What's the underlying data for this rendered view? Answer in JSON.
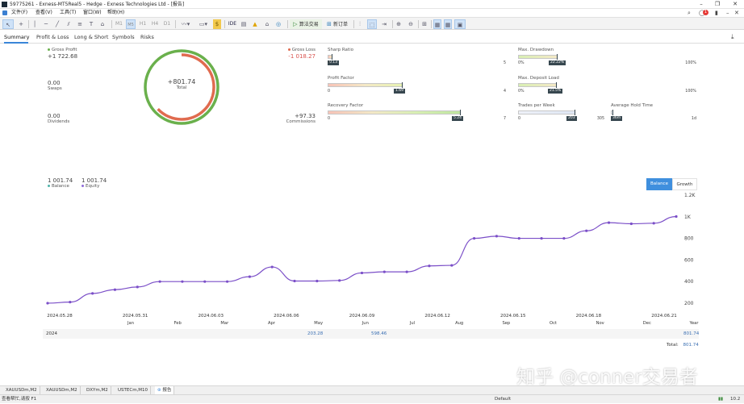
{
  "window": {
    "title": "59775261 - Exness-MT5Real5 - Hedge - Exness Technologies Ltd - [报告]"
  },
  "menu": {
    "items": [
      "文件(F)",
      "查看(V)",
      "工具(T)",
      "窗口(W)",
      "帮助(H)"
    ],
    "notification_count": "1"
  },
  "toolbar": {
    "timeframes": [
      "M1",
      "M5",
      "M15",
      "M30",
      "H1",
      "H4",
      "D1"
    ],
    "timeframes_short": {
      "m2": "M2",
      "m10": "M10"
    },
    "algo_trading": "算法交易",
    "new_order": "新订单",
    "ide_label": "IDE"
  },
  "tabs": [
    "Summary",
    "Profit & Loss",
    "Long & Short",
    "Symbols",
    "Risks"
  ],
  "summary": {
    "gross_profit_label": "Gross Profit",
    "gross_profit": "+1 722.68",
    "gross_loss_label": "Gross Loss",
    "gross_loss": "-1 018.27",
    "swaps_value": "0.00",
    "swaps_label": "Swaps",
    "dividends_value": "0.00",
    "dividends_label": "Dividends",
    "total_value": "+801.74",
    "total_label": "Total",
    "commissions_value": "+97.33",
    "commissions_label": "Commissions",
    "donut_profit_share": 0.63,
    "colors": {
      "profit": "#6ab04c",
      "loss": "#e06b4f"
    }
  },
  "gauges": [
    {
      "label": "Sharp Ratio",
      "min": "0",
      "max": "5",
      "value_label": "0.13",
      "value": 0.13,
      "range": 5
    },
    {
      "label": "Profit Factor",
      "min": "0",
      "max": "4",
      "value_label": "1.69",
      "value": 1.69,
      "range": 4
    },
    {
      "label": "Recovery Factor",
      "min": "0",
      "max": "7",
      "value_label": "5.24",
      "value": 5.24,
      "range": 7
    },
    {
      "label": "Max. Drawdown",
      "min": "0%",
      "max": "100%",
      "value_label": "22.22%",
      "value": 22.22,
      "range": 100
    },
    {
      "label": "Max. Deposit Load",
      "min": "0%",
      "max": "100%",
      "value_label": "21.5%",
      "value": 21.5,
      "range": 100
    },
    {
      "label": "Trades per Week",
      "min": "0",
      "max": "305",
      "value_label": "203",
      "value": 203,
      "range": 305
    },
    {
      "label": "Average Hold Time",
      "min": "",
      "max": "1d",
      "value_label": "36m",
      "value": 0.025,
      "range": 1
    }
  ],
  "balance": {
    "balance_value": "1 001.74",
    "balance_label": "Balance",
    "equity_value": "1 001.74",
    "equity_label": "Equity",
    "btn_balance": "Balance",
    "btn_growth": "Growth"
  },
  "chart_data": {
    "type": "line",
    "title": "",
    "xlabel": "",
    "ylabel": "",
    "ylim": [
      140,
      1200
    ],
    "y_ticks": [
      "200",
      "400",
      "600",
      "800",
      "1K",
      "1.2K"
    ],
    "x_ticks_top": [
      "2024.05.28",
      "2024.05.31",
      "2024.06.03",
      "2024.06.06",
      "2024.06.09",
      "2024.06.12",
      "2024.06.15",
      "2024.06.18",
      "2024.06.21"
    ],
    "x_ticks_months": [
      "Jan",
      "Feb",
      "Mar",
      "Apr",
      "May",
      "Jun",
      "Jul",
      "Aug",
      "Sep",
      "Oct",
      "Nov",
      "Dec",
      "Year"
    ],
    "series": [
      {
        "color": "#7b4fc8",
        "values": [
          200,
          210,
          290,
          325,
          350,
          400,
          400,
          400,
          400,
          445,
          535,
          405,
          405,
          410,
          480,
          490,
          490,
          545,
          550,
          800,
          820,
          800,
          800,
          800,
          870,
          945,
          935,
          940,
          1002
        ]
      }
    ]
  },
  "yearly": {
    "year": "2024",
    "may": "203.28",
    "jun": "598.46",
    "year_total": "801.74",
    "total_label": "Total:",
    "total_value": "801.74"
  },
  "bottom_tabs": [
    "XAUUSDm,M2",
    "XAUUSDm,M2",
    "DXYm,M2",
    "USTECm,M10",
    "报告"
  ],
  "status": {
    "help": "查看帮忙,请按 F1",
    "profile": "Default",
    "speed": "10.2"
  },
  "watermark": "知乎 @conner交易者"
}
